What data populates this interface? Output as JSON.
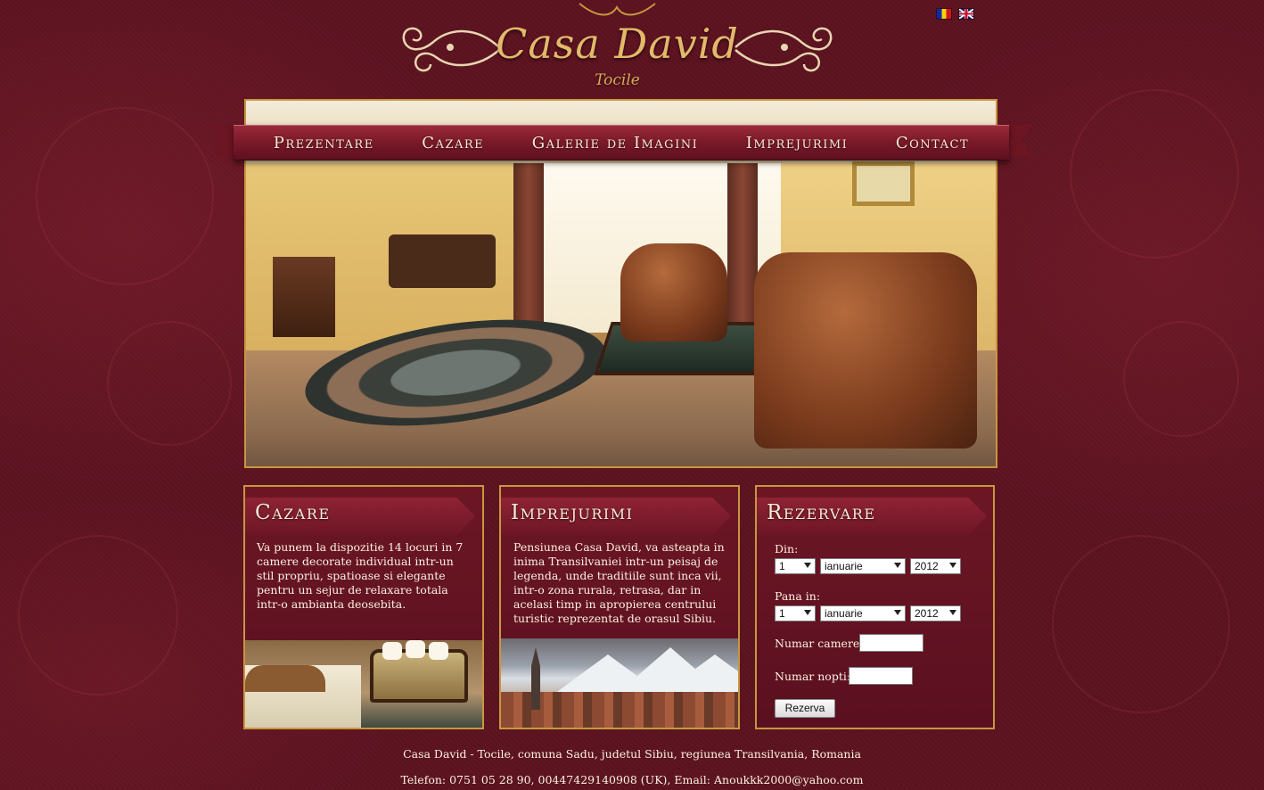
{
  "header": {
    "logo_title": "Casa David",
    "logo_subtitle": "Tocile",
    "languages": [
      "ro",
      "en"
    ]
  },
  "nav": {
    "items": [
      {
        "label": "Prezentare"
      },
      {
        "label": "Cazare"
      },
      {
        "label": "Galerie de Imagini"
      },
      {
        "label": "Imprejurimi"
      },
      {
        "label": "Contact"
      }
    ]
  },
  "cazare": {
    "title": "Cazare",
    "text": "Va punem la dispozitie 14 locuri in 7 camere decorate individual intr-un stil propriu, spatioase si elegante pentru un sejur de relaxare totala intr-o ambianta deosebita."
  },
  "imprejurimi": {
    "title": "Imprejurimi",
    "text": "Pensiunea Casa David, va asteapta in inima Transilvaniei intr-un peisaj de legenda, unde traditiile sunt inca vii, intr-o zona rurala, retrasa, dar in acelasi timp in apropierea centrului turistic reprezentat de orasul Sibiu."
  },
  "rezervare": {
    "title": "Rezervare",
    "from_label": "Din:",
    "to_label": "Pana in:",
    "from_day": "1",
    "from_month": "ianuarie",
    "from_year": "2012",
    "to_day": "1",
    "to_month": "ianuarie",
    "to_year": "2012",
    "rooms_label": "Numar camere:",
    "nights_label": "Numar nopti:",
    "rooms_value": "",
    "nights_value": "",
    "submit_label": "Rezerva"
  },
  "footer": {
    "address": "Casa David - Tocile, comuna Sadu, judetul Sibiu, regiunea Transilvania, Romania",
    "contact": "Telefon: 0751 05 28 90, 00447429140908 (UK), Email: Anoukkk2000@yahoo.com"
  },
  "colors": {
    "background": "#5c1220",
    "gold": "#c8973f",
    "ribbon": "#7c1a2a"
  }
}
